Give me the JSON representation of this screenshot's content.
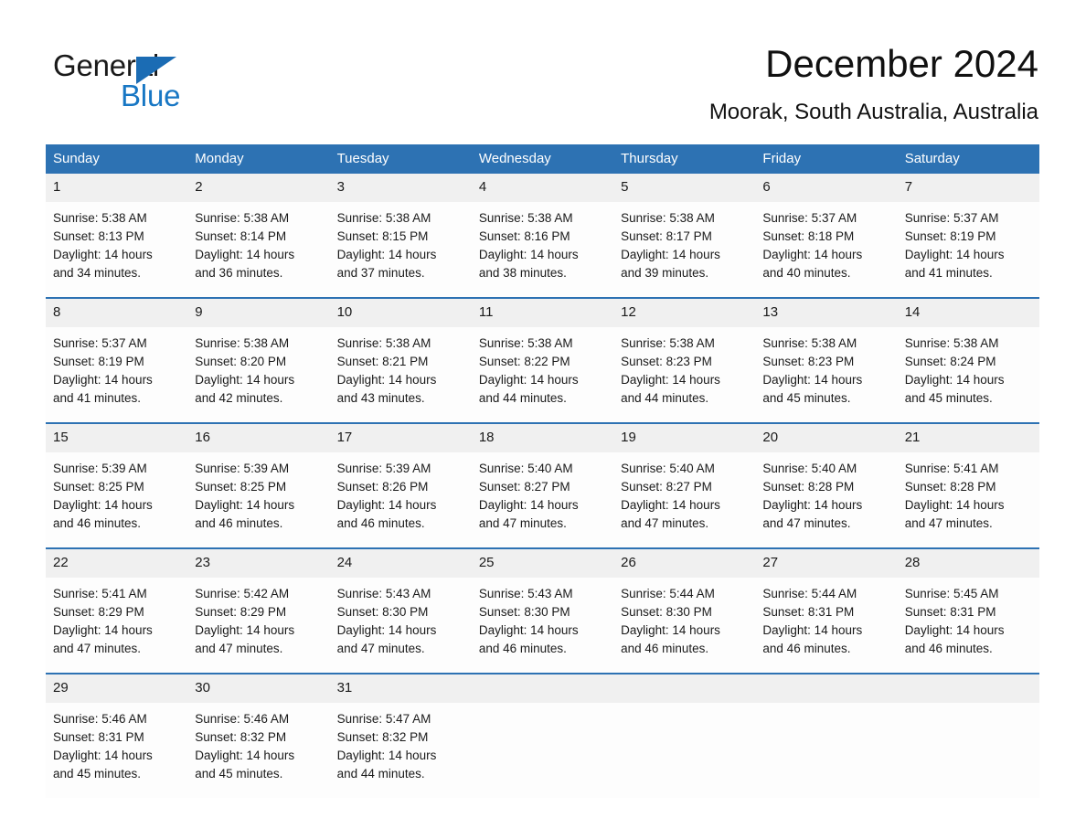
{
  "brand": {
    "name_part1": "General",
    "name_part2": "Blue",
    "triangle_color": "#1b6cb4",
    "blue_color": "#1877c4"
  },
  "header": {
    "title": "December 2024",
    "subtitle": "Moorak, South Australia, Australia"
  },
  "theme": {
    "header_bg": "#2d72b3",
    "daynum_bg": "#f0f0f0",
    "cell_bg": "#fdfdfd",
    "rule_color": "#2d72b3",
    "text_color": "#1a1a1a"
  },
  "weekdays": [
    "Sunday",
    "Monday",
    "Tuesday",
    "Wednesday",
    "Thursday",
    "Friday",
    "Saturday"
  ],
  "weeks": [
    {
      "days": [
        {
          "date": "1",
          "sunrise": "Sunrise: 5:38 AM",
          "sunset": "Sunset: 8:13 PM",
          "daylight_line1": "Daylight: 14 hours",
          "daylight_line2": "and 34 minutes."
        },
        {
          "date": "2",
          "sunrise": "Sunrise: 5:38 AM",
          "sunset": "Sunset: 8:14 PM",
          "daylight_line1": "Daylight: 14 hours",
          "daylight_line2": "and 36 minutes."
        },
        {
          "date": "3",
          "sunrise": "Sunrise: 5:38 AM",
          "sunset": "Sunset: 8:15 PM",
          "daylight_line1": "Daylight: 14 hours",
          "daylight_line2": "and 37 minutes."
        },
        {
          "date": "4",
          "sunrise": "Sunrise: 5:38 AM",
          "sunset": "Sunset: 8:16 PM",
          "daylight_line1": "Daylight: 14 hours",
          "daylight_line2": "and 38 minutes."
        },
        {
          "date": "5",
          "sunrise": "Sunrise: 5:38 AM",
          "sunset": "Sunset: 8:17 PM",
          "daylight_line1": "Daylight: 14 hours",
          "daylight_line2": "and 39 minutes."
        },
        {
          "date": "6",
          "sunrise": "Sunrise: 5:37 AM",
          "sunset": "Sunset: 8:18 PM",
          "daylight_line1": "Daylight: 14 hours",
          "daylight_line2": "and 40 minutes."
        },
        {
          "date": "7",
          "sunrise": "Sunrise: 5:37 AM",
          "sunset": "Sunset: 8:19 PM",
          "daylight_line1": "Daylight: 14 hours",
          "daylight_line2": "and 41 minutes."
        }
      ]
    },
    {
      "days": [
        {
          "date": "8",
          "sunrise": "Sunrise: 5:37 AM",
          "sunset": "Sunset: 8:19 PM",
          "daylight_line1": "Daylight: 14 hours",
          "daylight_line2": "and 41 minutes."
        },
        {
          "date": "9",
          "sunrise": "Sunrise: 5:38 AM",
          "sunset": "Sunset: 8:20 PM",
          "daylight_line1": "Daylight: 14 hours",
          "daylight_line2": "and 42 minutes."
        },
        {
          "date": "10",
          "sunrise": "Sunrise: 5:38 AM",
          "sunset": "Sunset: 8:21 PM",
          "daylight_line1": "Daylight: 14 hours",
          "daylight_line2": "and 43 minutes."
        },
        {
          "date": "11",
          "sunrise": "Sunrise: 5:38 AM",
          "sunset": "Sunset: 8:22 PM",
          "daylight_line1": "Daylight: 14 hours",
          "daylight_line2": "and 44 minutes."
        },
        {
          "date": "12",
          "sunrise": "Sunrise: 5:38 AM",
          "sunset": "Sunset: 8:23 PM",
          "daylight_line1": "Daylight: 14 hours",
          "daylight_line2": "and 44 minutes."
        },
        {
          "date": "13",
          "sunrise": "Sunrise: 5:38 AM",
          "sunset": "Sunset: 8:23 PM",
          "daylight_line1": "Daylight: 14 hours",
          "daylight_line2": "and 45 minutes."
        },
        {
          "date": "14",
          "sunrise": "Sunrise: 5:38 AM",
          "sunset": "Sunset: 8:24 PM",
          "daylight_line1": "Daylight: 14 hours",
          "daylight_line2": "and 45 minutes."
        }
      ]
    },
    {
      "days": [
        {
          "date": "15",
          "sunrise": "Sunrise: 5:39 AM",
          "sunset": "Sunset: 8:25 PM",
          "daylight_line1": "Daylight: 14 hours",
          "daylight_line2": "and 46 minutes."
        },
        {
          "date": "16",
          "sunrise": "Sunrise: 5:39 AM",
          "sunset": "Sunset: 8:25 PM",
          "daylight_line1": "Daylight: 14 hours",
          "daylight_line2": "and 46 minutes."
        },
        {
          "date": "17",
          "sunrise": "Sunrise: 5:39 AM",
          "sunset": "Sunset: 8:26 PM",
          "daylight_line1": "Daylight: 14 hours",
          "daylight_line2": "and 46 minutes."
        },
        {
          "date": "18",
          "sunrise": "Sunrise: 5:40 AM",
          "sunset": "Sunset: 8:27 PM",
          "daylight_line1": "Daylight: 14 hours",
          "daylight_line2": "and 47 minutes."
        },
        {
          "date": "19",
          "sunrise": "Sunrise: 5:40 AM",
          "sunset": "Sunset: 8:27 PM",
          "daylight_line1": "Daylight: 14 hours",
          "daylight_line2": "and 47 minutes."
        },
        {
          "date": "20",
          "sunrise": "Sunrise: 5:40 AM",
          "sunset": "Sunset: 8:28 PM",
          "daylight_line1": "Daylight: 14 hours",
          "daylight_line2": "and 47 minutes."
        },
        {
          "date": "21",
          "sunrise": "Sunrise: 5:41 AM",
          "sunset": "Sunset: 8:28 PM",
          "daylight_line1": "Daylight: 14 hours",
          "daylight_line2": "and 47 minutes."
        }
      ]
    },
    {
      "days": [
        {
          "date": "22",
          "sunrise": "Sunrise: 5:41 AM",
          "sunset": "Sunset: 8:29 PM",
          "daylight_line1": "Daylight: 14 hours",
          "daylight_line2": "and 47 minutes."
        },
        {
          "date": "23",
          "sunrise": "Sunrise: 5:42 AM",
          "sunset": "Sunset: 8:29 PM",
          "daylight_line1": "Daylight: 14 hours",
          "daylight_line2": "and 47 minutes."
        },
        {
          "date": "24",
          "sunrise": "Sunrise: 5:43 AM",
          "sunset": "Sunset: 8:30 PM",
          "daylight_line1": "Daylight: 14 hours",
          "daylight_line2": "and 47 minutes."
        },
        {
          "date": "25",
          "sunrise": "Sunrise: 5:43 AM",
          "sunset": "Sunset: 8:30 PM",
          "daylight_line1": "Daylight: 14 hours",
          "daylight_line2": "and 46 minutes."
        },
        {
          "date": "26",
          "sunrise": "Sunrise: 5:44 AM",
          "sunset": "Sunset: 8:30 PM",
          "daylight_line1": "Daylight: 14 hours",
          "daylight_line2": "and 46 minutes."
        },
        {
          "date": "27",
          "sunrise": "Sunrise: 5:44 AM",
          "sunset": "Sunset: 8:31 PM",
          "daylight_line1": "Daylight: 14 hours",
          "daylight_line2": "and 46 minutes."
        },
        {
          "date": "28",
          "sunrise": "Sunrise: 5:45 AM",
          "sunset": "Sunset: 8:31 PM",
          "daylight_line1": "Daylight: 14 hours",
          "daylight_line2": "and 46 minutes."
        }
      ]
    },
    {
      "days": [
        {
          "date": "29",
          "sunrise": "Sunrise: 5:46 AM",
          "sunset": "Sunset: 8:31 PM",
          "daylight_line1": "Daylight: 14 hours",
          "daylight_line2": "and 45 minutes."
        },
        {
          "date": "30",
          "sunrise": "Sunrise: 5:46 AM",
          "sunset": "Sunset: 8:32 PM",
          "daylight_line1": "Daylight: 14 hours",
          "daylight_line2": "and 45 minutes."
        },
        {
          "date": "31",
          "sunrise": "Sunrise: 5:47 AM",
          "sunset": "Sunset: 8:32 PM",
          "daylight_line1": "Daylight: 14 hours",
          "daylight_line2": "and 44 minutes."
        },
        {
          "date": "",
          "sunrise": "",
          "sunset": "",
          "daylight_line1": "",
          "daylight_line2": ""
        },
        {
          "date": "",
          "sunrise": "",
          "sunset": "",
          "daylight_line1": "",
          "daylight_line2": ""
        },
        {
          "date": "",
          "sunrise": "",
          "sunset": "",
          "daylight_line1": "",
          "daylight_line2": ""
        },
        {
          "date": "",
          "sunrise": "",
          "sunset": "",
          "daylight_line1": "",
          "daylight_line2": ""
        }
      ]
    }
  ]
}
